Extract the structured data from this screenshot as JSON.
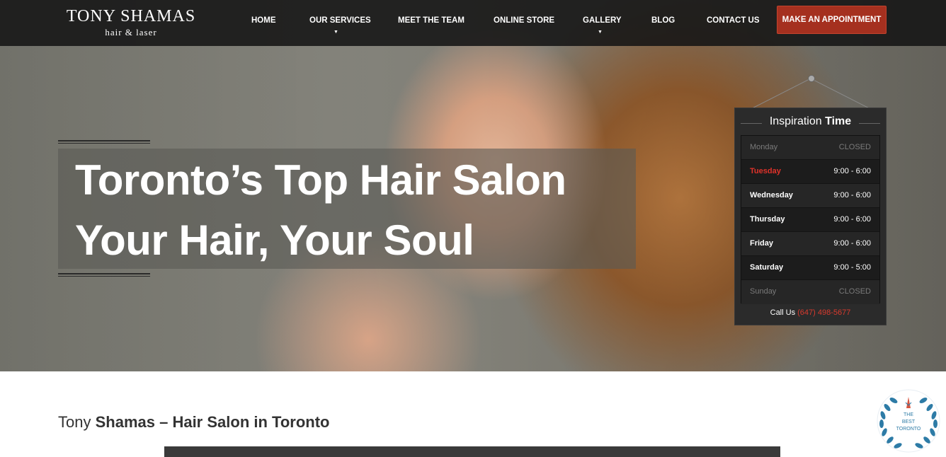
{
  "brand": {
    "name": "TONY SHAMAS",
    "tagline": "hair & laser"
  },
  "nav": {
    "items": [
      {
        "label": "HOME",
        "dropdown": false
      },
      {
        "label": "OUR SERVICES",
        "dropdown": true
      },
      {
        "label": "MEET THE TEAM",
        "dropdown": false
      },
      {
        "label": "ONLINE STORE",
        "dropdown": false
      },
      {
        "label": "GALLERY",
        "dropdown": true
      },
      {
        "label": "BLOG",
        "dropdown": false
      },
      {
        "label": "CONTACT US",
        "dropdown": false
      }
    ],
    "cta_label": "MAKE AN APPOINTMENT"
  },
  "hero": {
    "line1": "Toronto’s Top Hair Salon",
    "line2": "Your Hair, Your Soul"
  },
  "hours": {
    "title_light": "Inspiration",
    "title_bold": "Time",
    "rows": [
      {
        "day": "Monday",
        "time": "CLOSED"
      },
      {
        "day": "Tuesday",
        "time": "9:00 - 6:00"
      },
      {
        "day": "Wednesday",
        "time": "9:00 - 6:00"
      },
      {
        "day": "Thursday",
        "time": "9:00 - 6:00"
      },
      {
        "day": "Friday",
        "time": "9:00 - 6:00"
      },
      {
        "day": "Saturday",
        "time": "9:00 - 5:00"
      },
      {
        "day": "Sunday",
        "time": "CLOSED"
      }
    ],
    "call_label": "Call Us",
    "phone": "(647) 498-5677"
  },
  "section": {
    "title_light": "Tony",
    "title_bold": "Shamas – Hair Salon in Toronto"
  },
  "badge": {
    "line1": "THE",
    "line2": "BEST",
    "line3": "TORONTO"
  },
  "colors": {
    "accent": "#a5301f",
    "highlight": "#e0322a",
    "navbar": "#141414"
  }
}
